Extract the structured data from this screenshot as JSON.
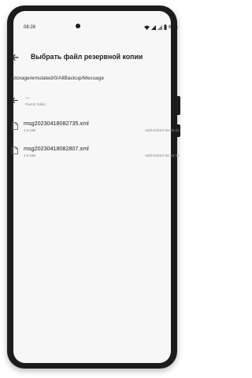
{
  "status_bar": {
    "time": "08:28",
    "battery": "63%",
    "icons": [
      "wifi-icon",
      "signal-icon",
      "signal-icon",
      "battery-icon"
    ]
  },
  "toolbar": {
    "title": "Выбрать файл резервной копии"
  },
  "path": "/storage/emulated/0/AllBackup/Message",
  "parent": {
    "dots": "...",
    "label": "Parent folder"
  },
  "files": [
    {
      "name": "msg20230418082735.xml",
      "size": "1.6 MB",
      "date": "18/04/2023 08:28:02"
    },
    {
      "name": "msg20230418082807.xml",
      "size": "1.6 MB",
      "date": "18/04/2023 08:28:32"
    }
  ],
  "colors": {
    "screen_bg": "#f7f7f7",
    "text": "#1e1e1e",
    "muted": "#888888"
  }
}
